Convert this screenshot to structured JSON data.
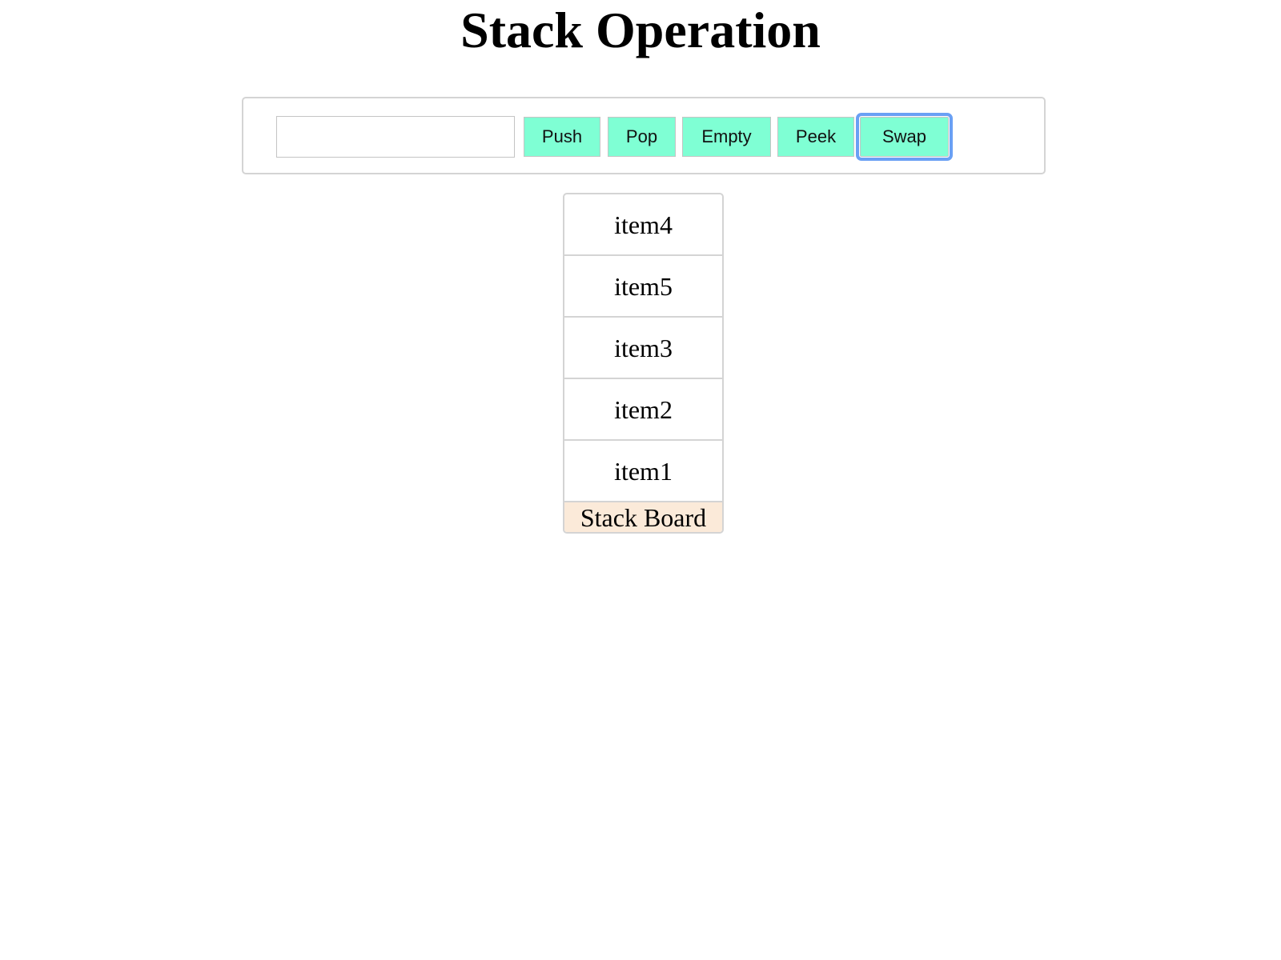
{
  "page": {
    "title": "Stack Operation"
  },
  "controls": {
    "input_value": "",
    "input_placeholder": "",
    "buttons": {
      "push": "Push",
      "pop": "Pop",
      "empty": "Empty",
      "peek": "Peek",
      "swap": "Swap"
    },
    "focused_button": "swap"
  },
  "stack": {
    "items": [
      "item4",
      "item5",
      "item3",
      "item2",
      "item1"
    ],
    "label": "Stack Board"
  },
  "colors": {
    "button_background": "#7fffd4",
    "focus_ring": "#6aa0f4",
    "board_label_background": "#fbead9",
    "border": "#d4d4d4"
  }
}
